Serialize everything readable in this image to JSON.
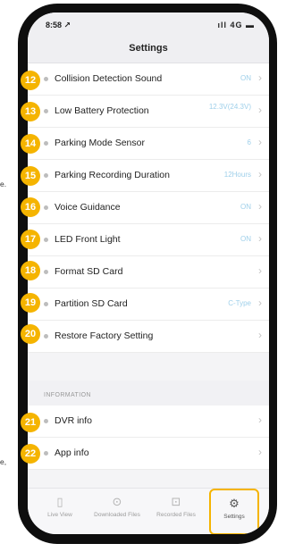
{
  "cut_text": {
    "e": "e.",
    "e2": "e,",
    "c": ""
  },
  "status": {
    "time": "8:58 ↗",
    "signal": "ıll 4G ▬"
  },
  "nav": {
    "title": "Settings"
  },
  "rows": [
    {
      "badge": "12",
      "label": "Collision Detection Sound",
      "value": "ON",
      "chevron": "›"
    },
    {
      "badge": "13",
      "label": "Low Battery Protection",
      "value": "12.3V(24.3V)",
      "chevron": "›"
    },
    {
      "badge": "14",
      "label": "Parking Mode Sensor",
      "value": "6",
      "chevron": "›"
    },
    {
      "badge": "15",
      "label": "Parking Recording Duration",
      "value": "12Hours",
      "chevron": "›"
    },
    {
      "badge": "16",
      "label": "Voice Guidance",
      "value": "ON",
      "chevron": "›"
    },
    {
      "badge": "17",
      "label": "LED Front Light",
      "value": "ON",
      "chevron": "›"
    },
    {
      "badge": "18",
      "label": "Format SD Card",
      "value": "",
      "chevron": "›"
    },
    {
      "badge": "19",
      "label": "Partition SD Card",
      "value": "C-Type",
      "chevron": "›"
    },
    {
      "badge": "20",
      "label": "Restore Factory Setting",
      "value": "",
      "chevron": "›"
    }
  ],
  "section": {
    "title": "INFORMATION"
  },
  "info_rows": [
    {
      "badge": "21",
      "label": "DVR info",
      "value": "",
      "chevron": "›"
    },
    {
      "badge": "22",
      "label": "App info",
      "value": "",
      "chevron": "›"
    }
  ],
  "tabs": [
    {
      "icon": "▯",
      "label": "Live View"
    },
    {
      "icon": "⊙",
      "label": "Downloaded Files"
    },
    {
      "icon": "⊡",
      "label": "Recorded Files"
    },
    {
      "icon": "⚙",
      "label": "Settings"
    }
  ],
  "colors": {
    "badge": "#f5b400",
    "value": "#9fd0ea",
    "active_tab": "#f5b400"
  }
}
